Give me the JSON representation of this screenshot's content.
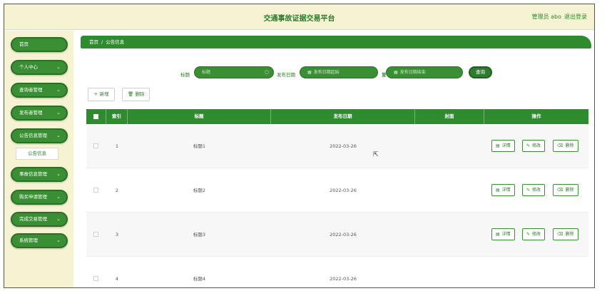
{
  "header": {
    "title": "交通事故证据交易平台",
    "admin": "管理员 abo",
    "logout": "退出登录"
  },
  "sidebar": {
    "items": [
      {
        "label": "首页",
        "chevron": ""
      },
      {
        "label": "个人中心",
        "chevron": "⌄"
      },
      {
        "label": "查询者管理",
        "chevron": "⌄"
      },
      {
        "label": "发布者管理",
        "chevron": "⌄"
      },
      {
        "label": "公告信息管理",
        "chevron": "⌄"
      },
      {
        "label": "事故信息管理",
        "chevron": "⌄"
      },
      {
        "label": "购买申请管理",
        "chevron": "⌄"
      },
      {
        "label": "完成交易管理",
        "chevron": "⌄"
      },
      {
        "label": "系统管理",
        "chevron": "⌄"
      }
    ],
    "submenu": {
      "label": "公告信息"
    }
  },
  "breadcrumb": {
    "home": "首页",
    "sep": "/",
    "current": "公告信息"
  },
  "search": {
    "title_label": "标题",
    "title_placeholder": "标题",
    "date_label": "发布日期",
    "date_start_placeholder": "发布日期起始",
    "to_label": "至",
    "date_end_placeholder": "发布日期结束",
    "query_button": "查询"
  },
  "toolbar": {
    "add_label": "新增",
    "delete_label": "删除"
  },
  "table": {
    "columns": [
      "索引",
      "标题",
      "发布日期",
      "封面",
      "操作"
    ],
    "rows": [
      {
        "index": "1",
        "title": "标题1",
        "date": "2022-03-26"
      },
      {
        "index": "2",
        "title": "标题2",
        "date": "2022-03-26"
      },
      {
        "index": "3",
        "title": "标题3",
        "date": "2022-03-26"
      },
      {
        "index": "4",
        "title": "标题4",
        "date": "2022-03-26"
      }
    ],
    "actions": {
      "detail": "详情",
      "edit": "修改",
      "delete": "删除"
    }
  },
  "colors": {
    "primary": "#2e8b2e",
    "sidebar_bg": "#f6f3d3",
    "accent_text": "#2b7a2b"
  }
}
